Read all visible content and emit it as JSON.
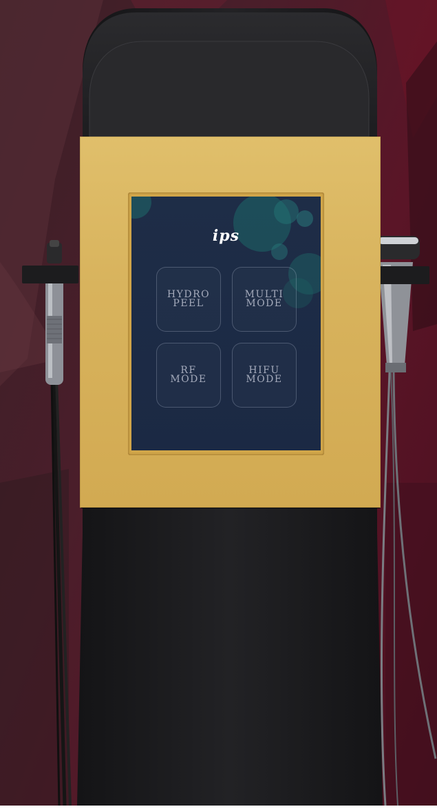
{
  "screen": {
    "logo": "ips",
    "buttons": [
      {
        "line1": "HYDRO",
        "line2": "PEEL"
      },
      {
        "line1": "MULTI",
        "line2": "MODE"
      },
      {
        "line1": "RF",
        "line2": "MODE"
      },
      {
        "line1": "HIFU",
        "line2": "MODE"
      }
    ]
  },
  "colors": {
    "background": "#4a1e2a",
    "device_body": "#1c1c1e",
    "gold_frame": "#d8b35d",
    "screen_bg": "#1e2d47",
    "screen_accent": "#1f6a6a",
    "tile_text": "#a4aabb"
  }
}
